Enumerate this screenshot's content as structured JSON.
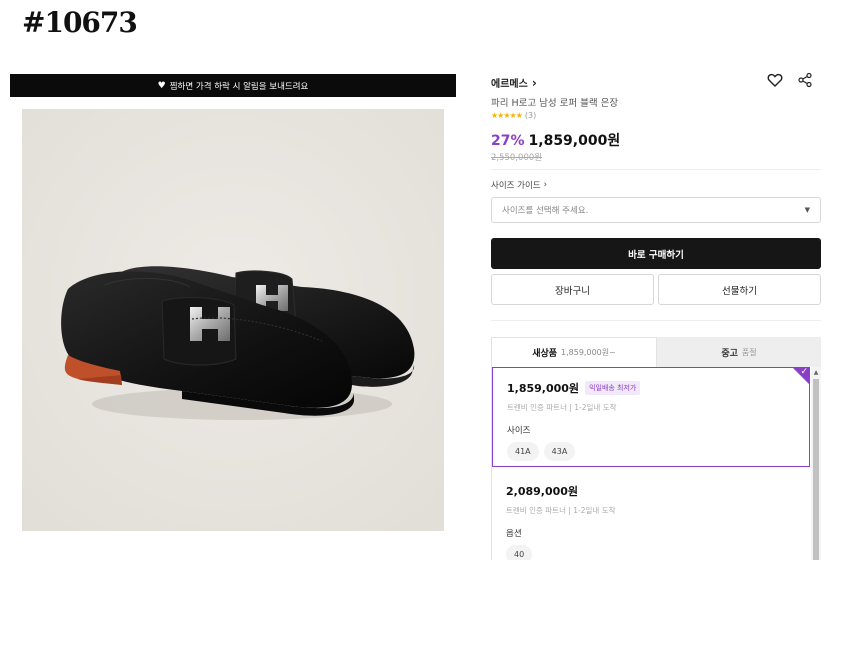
{
  "id_label": "#10673",
  "notice_bar": {
    "icon": "heart-icon",
    "text": "찜하면 가격 하락 시 알림을 보내드려요"
  },
  "product": {
    "brand": "에르메스",
    "name": "파리 H로고 남성 로퍼 블랙 은장",
    "rating_count": "(3)",
    "rating_stars": 4.5,
    "discount": "27%",
    "price": "1,859,000원",
    "original_price": "2,550,000원"
  },
  "size_guide": "사이즈 가이드",
  "size_select": {
    "placeholder": "사이즈를 선택해 주세요."
  },
  "buttons": {
    "buy": "바로 구매하기",
    "cart": "장바구니",
    "gift": "선물하기"
  },
  "tabs": [
    {
      "label": "새상품",
      "sub": "1,859,000원~"
    },
    {
      "label": "중고",
      "sub": "품절"
    }
  ],
  "offers": [
    {
      "price": "1,859,000원",
      "tag": "익일배송 최저가",
      "meta": "트렌비 인증 파트너 | 1-2일내 도착",
      "option_label": "사이즈",
      "options": [
        "41A",
        "43A"
      ]
    },
    {
      "price": "2,089,000원",
      "tag": "",
      "meta": "트렌비 인증 파트너 | 1-2일내 도착",
      "option_label": "옵션",
      "options": [
        "40"
      ]
    }
  ],
  "colors": {
    "accent": "#8a3fc7",
    "star": "#f4b400",
    "dark": "#161616"
  }
}
